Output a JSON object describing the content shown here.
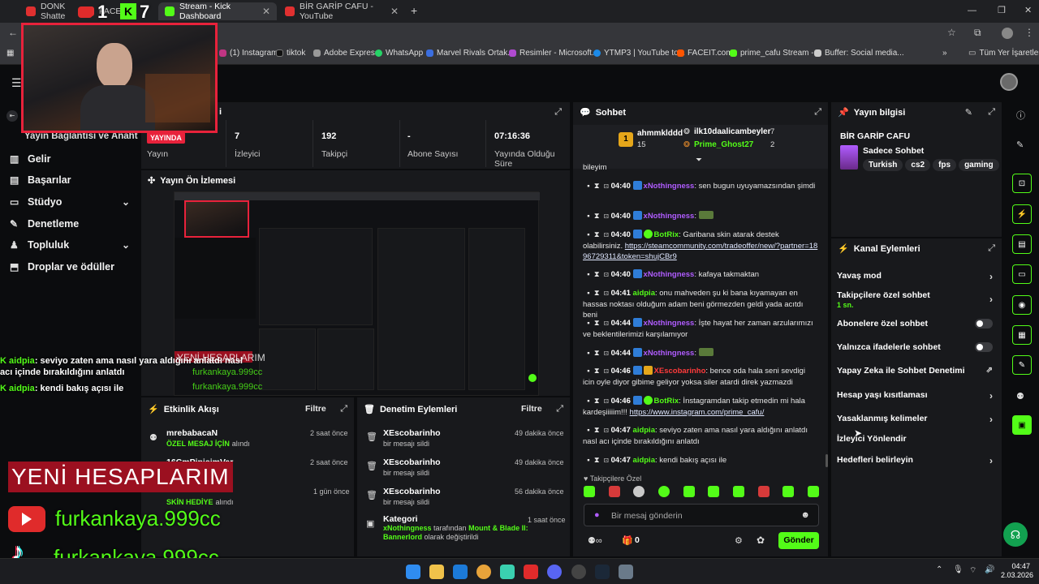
{
  "browser": {
    "tabs": [
      {
        "label": "DONK Shatte"
      },
      {
        "label": "FACEIT K"
      },
      {
        "label": "Stream - Kick Dashboard"
      },
      {
        "label": "BİR GARİP CAFU - YouTube"
      }
    ],
    "bookmarks": [
      "(1) Instagram",
      "tiktok",
      "Adobe Express",
      "WhatsApp",
      "Marvel Rivals Ortak...",
      "Resimler - Microsoft...",
      "YTMP3 | YouTube to...",
      "FACEIT.com",
      "prime_cafu Stream -...",
      "Buffer: Social media..."
    ],
    "all_bookmarks": "Tüm Yer İşaretleri"
  },
  "nav": {
    "items": [
      {
        "label": "Gelir"
      },
      {
        "label": "Başarılar"
      },
      {
        "label": "Stüdyo"
      },
      {
        "label": "Denetleme"
      },
      {
        "label": "Topluluk"
      },
      {
        "label": "Droplar ve ödüller"
      }
    ],
    "partial_item": "Yayın Bağlantısı ve Anahtarı"
  },
  "stats": {
    "live_badge": "YAYINDA",
    "items": [
      {
        "value": "",
        "label": "Yayın"
      },
      {
        "value": "7",
        "label": "İzleyici"
      },
      {
        "value": "192",
        "label": "Takipçi"
      },
      {
        "value": "-",
        "label": "Abone Sayısı"
      },
      {
        "value": "07:16:36",
        "label": "Yayında Olduğu Süre"
      }
    ]
  },
  "preview": {
    "title": "Yayın Ön İzlemesi"
  },
  "activity": {
    "title": "Etkinlik Akışı",
    "filter": "Filtre",
    "items": [
      {
        "user": "mrebabacaN",
        "highlight": "ÖZEL MESAJ İÇİN",
        "suffix": "alındı",
        "time": "2 saat önce"
      },
      {
        "user": "16CmPipisimVar",
        "highlight": "",
        "suffix": "",
        "time": "2 saat önce"
      },
      {
        "user": "",
        "highlight": "SKİN HEDİYE",
        "suffix": "alındı",
        "time": "1 gün önce"
      }
    ]
  },
  "moderation": {
    "title": "Denetim Eylemleri",
    "filter": "Filtre",
    "items": [
      {
        "user": "XEscobarinho",
        "desc": "bir mesajı sildi",
        "time": "49 dakika önce"
      },
      {
        "user": "XEscobarinho",
        "desc": "bir mesajı sildi",
        "time": "49 dakika önce"
      },
      {
        "user": "XEscobarinho",
        "desc": "bir mesajı sildi",
        "time": "56 dakika önce"
      }
    ],
    "category": {
      "title": "Kategori",
      "time": "1 saat önce",
      "user": "xNothingness",
      "mid": "tarafından",
      "game": "Mount & Blade II: Bannerlord",
      "tail": "olarak değiştirildi"
    }
  },
  "chat": {
    "title": "Sohbet",
    "top": {
      "first": {
        "rank": "1",
        "name": "ahmmklddd",
        "count": "15"
      },
      "second": {
        "name": "ilk10daalicambeyler",
        "count": "7"
      },
      "third": {
        "name": "Prime_Ghost27",
        "count": "2"
      }
    },
    "truncated": "bileyim",
    "messages": [
      {
        "time": "04:40",
        "user": "xNothingness",
        "text": ": sen bugun uyuyamazsından şimdi"
      },
      {
        "time": "04:40",
        "user": "xNothingness",
        "text": ":"
      },
      {
        "time": "04:40",
        "user": "BotRix",
        "text": ": Garibana skin atarak destek olabilirsiniz. ",
        "link": "https://steamcommunity.com/tradeoffer/new/?partner=1896729311&token=shujCBr9"
      },
      {
        "time": "04:40",
        "user": "xNothingness",
        "text": ": kafaya takmaktan"
      },
      {
        "time": "04:41",
        "user": "aidpia",
        "text": ": onu mahveden şu ki bana kıyamayan en hassas noktası olduğum adam beni görmezden geldi yada acıtdı beni"
      },
      {
        "time": "04:44",
        "user": "xNothingness",
        "text": ": İşte hayat her zaman arzularımızı ve beklentilerimizi karşılamıyor"
      },
      {
        "time": "04:44",
        "user": "xNothingness",
        "text": ":"
      },
      {
        "time": "04:46",
        "user": "XEscobarinho",
        "text": ": bence oda hala seni sevdigi icin oyle diyor gibime geliyor yoksa siler atardi direk yazmazdi"
      },
      {
        "time": "04:46",
        "user": "BotRix",
        "text": ": İnstagramdan takip etmedin mi hala kardeşiiiiim!!! ",
        "link": "https://www.instagram.com/prime_cafu/"
      },
      {
        "time": "04:47",
        "user": "aidpia",
        "text": ": seviyo zaten ama nasıl yara aldığını anlatdı nasl acı içinde bırakıldığını anlatdı"
      },
      {
        "time": "04:47",
        "user": "aidpia",
        "text": ": kendi bakış açısı ile"
      }
    ],
    "mode": "Takipçilere Özel",
    "input_placeholder": "Bir mesaj gönderin",
    "points": "0",
    "send": "Gönder"
  },
  "stream_info": {
    "title": "Yayın bilgisi",
    "channel": "BİR GARİP CAFU",
    "category": "Sadece Sohbet",
    "tags": [
      "Turkish",
      "cs2",
      "fps",
      "gaming"
    ]
  },
  "channel_actions": {
    "title": "Kanal Eylemleri",
    "items": [
      {
        "label": "Yavaş mod",
        "sub": "",
        "control": "arrow"
      },
      {
        "label": "Takipçilere özel sohbet",
        "sub": "1 sn.",
        "control": "arrow"
      },
      {
        "label": "Abonelere özel sohbet",
        "sub": "",
        "control": "toggle"
      },
      {
        "label": "Yalnızca ifadelerle sohbet",
        "sub": "",
        "control": "toggle"
      },
      {
        "label": "Yapay Zeka ile Sohbet Denetimi",
        "sub": "",
        "control": "external"
      },
      {
        "label": "Hesap yaşı kısıtlaması",
        "sub": "",
        "control": "arrow"
      },
      {
        "label": "Yasaklanmış kelimeler",
        "sub": "",
        "control": "arrow"
      },
      {
        "label": "İzleyici Yönlendir",
        "sub": "",
        "control": "none"
      },
      {
        "label": "Hedefleri belirleyin",
        "sub": "",
        "control": "arrow"
      }
    ]
  },
  "overlay": {
    "chat": [
      {
        "user": "aidpia",
        "text": ": seviyo zaten ama nasıl yara aldığını anlatdı nasl acı içinde bırakıldığını anlatdı"
      },
      {
        "user": "aidpia",
        "text": ": kendi bakış açısı ile"
      }
    ],
    "banner": "YENİ HESAPLARIM",
    "youtube": "furkankaya.999cc",
    "tiktok": "furkankaya.999cc",
    "counter_a": "1",
    "counter_b": "7"
  },
  "taskbar": {
    "time": "04:47",
    "date": "2.03.2026"
  },
  "colors": {
    "accent": "#53fc18",
    "bg": "#0b0c0e",
    "panel": "#18191c"
  }
}
